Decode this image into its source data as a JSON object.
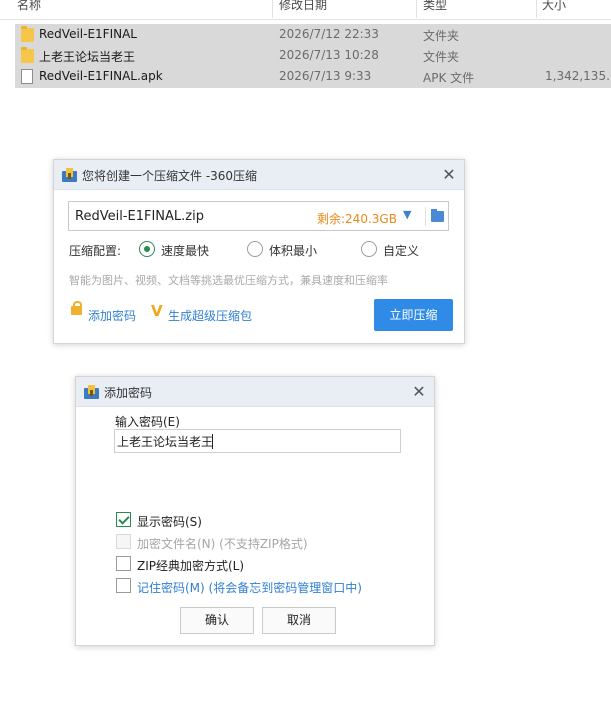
{
  "explorer": {
    "columns": [
      "名称",
      "修改日期",
      "类型",
      "大小"
    ],
    "rows": [
      {
        "name": "RedVeil-E1FINAL",
        "date": "2026/7/12 22:33",
        "type": "文件夹",
        "size": "",
        "icon": "folder-icon"
      },
      {
        "name": "上老王论坛当老王",
        "date": "2026/7/13 10:28",
        "type": "文件夹",
        "size": "",
        "icon": "folder-icon"
      },
      {
        "name": "RedVeil-E1FINAL.apk",
        "date": "2026/7/13 9:33",
        "type": "APK 文件",
        "size": "1,342,135...",
        "icon": "file-icon"
      }
    ]
  },
  "compress_dialog": {
    "title": "您将创建一个压缩文件 -360压缩",
    "filename": "RedVeil-E1FINAL.zip",
    "space_left": "剩余:240.3GB",
    "config_label": "压缩配置:",
    "options": [
      "速度最快",
      "体积最小",
      "自定义"
    ],
    "selected_option": "速度最快",
    "hint": "智能为图片、视频、文档等挑选最优压缩方式，兼具速度和压缩率",
    "add_password": "添加密码",
    "super_package": "生成超级压缩包",
    "compress_button": "立即压缩",
    "accent_color": "#2f8be6"
  },
  "password_dialog": {
    "title": "添加密码",
    "input_label": "输入密码(E)",
    "password_value": "上老王论坛当老王",
    "checkboxes": [
      {
        "label": "显示密码(S)",
        "checked": true,
        "disabled": false
      },
      {
        "label": "加密文件名(N) (不支持ZIP格式)",
        "checked": false,
        "disabled": true
      },
      {
        "label": "ZIP经典加密方式(L)",
        "checked": false,
        "disabled": false
      },
      {
        "label": "记住密码(M) (将会备忘到密码管理窗口中)",
        "checked": false,
        "disabled": false
      }
    ],
    "ok_button": "确认",
    "cancel_button": "取消"
  }
}
